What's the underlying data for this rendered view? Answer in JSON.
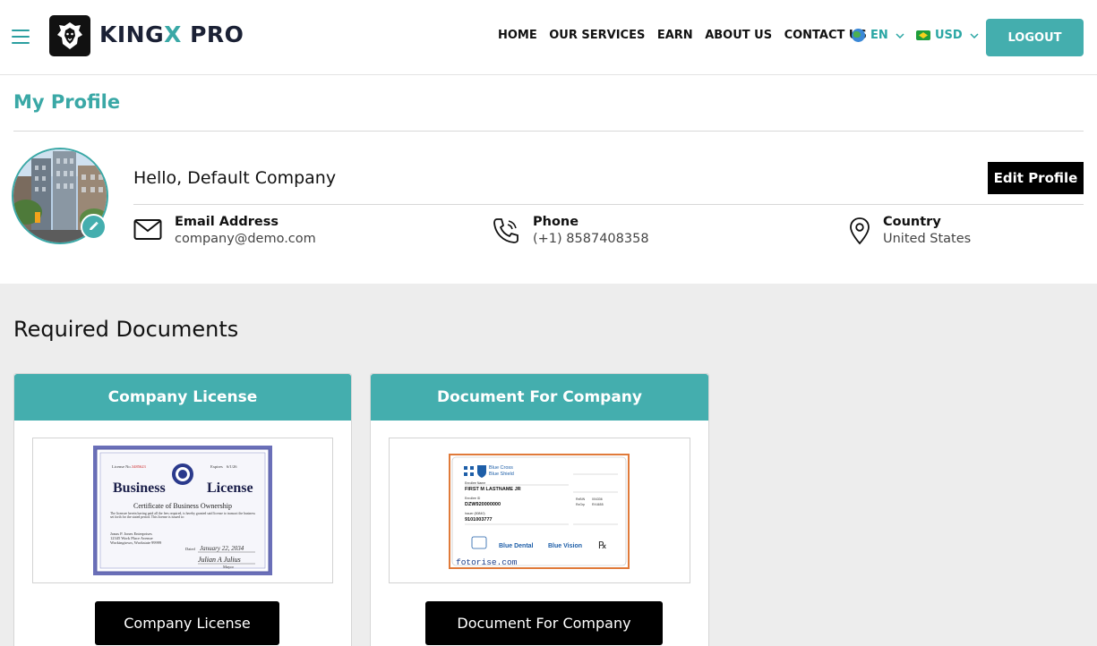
{
  "header": {
    "brand_prefix": "KING",
    "brand_x": "X",
    "brand_suffix": " PRO",
    "nav": [
      "HOME",
      "OUR SERVICES",
      "EARN",
      "ABOUT US",
      "CONTACT US"
    ],
    "language": "EN",
    "currency": "USD",
    "logout_label": "LOGOUT",
    "icons": [
      "menu-icon",
      "lion-logo-icon",
      "globe-icon",
      "chevron-down-icon",
      "brazil-flag-icon"
    ]
  },
  "profile": {
    "title": "My Profile",
    "greeting": "Hello, Default Company",
    "edit_label": "Edit Profile",
    "email_label": "Email Address",
    "email_value": "company@demo.com",
    "phone_label": "Phone",
    "phone_value": "(+1) 8587408358",
    "country_label": "Country",
    "country_value": "United States"
  },
  "documents": {
    "title": "Required Documents",
    "cards": [
      {
        "header": "Company License",
        "button": "Company License"
      },
      {
        "header": "Document For Company",
        "button": "Document For Company"
      }
    ]
  },
  "license_doc": {
    "top_left": "3485623",
    "top_right": "6/1/26",
    "title1": "Business",
    "title2": "License",
    "subtitle": "Certificate of Business Ownership",
    "body": "The licensee herein having paid all the fees required, is hereby granted said license to transact the business set forth for the stated period. This license is issued to:",
    "name": "Jonas P. Jones Enterprises",
    "address1": "12345 Work Place Avenue",
    "address2": "Workingtown, Workstate 99999",
    "dated": "January 22, 2034",
    "signature": "Julian A Julius",
    "mayor": "Mayor"
  },
  "insurance_doc": {
    "brand1": "Blue Cross",
    "brand2": "Blue Shield",
    "enrollee_name_label": "Enrollee Name",
    "name": "FIRST M LASTNAME JR",
    "enrollee_id_label": "Enrollee ID",
    "id": "DZW920000000",
    "issuer_label": "Issuer (80840)",
    "issuer": "9101003777",
    "rxbin_label": "RxBIN",
    "rxbin": "004336",
    "rxgrp_label": "RxGrp",
    "rxgrp": "RX4655",
    "dental": "Blue Dental",
    "vision": "Blue Vision",
    "rx": "℞",
    "watermark": "fotorise.com"
  },
  "colors": {
    "accent": "#44aeae",
    "brand_dark": "#1b2135",
    "button_dark": "#000000"
  }
}
